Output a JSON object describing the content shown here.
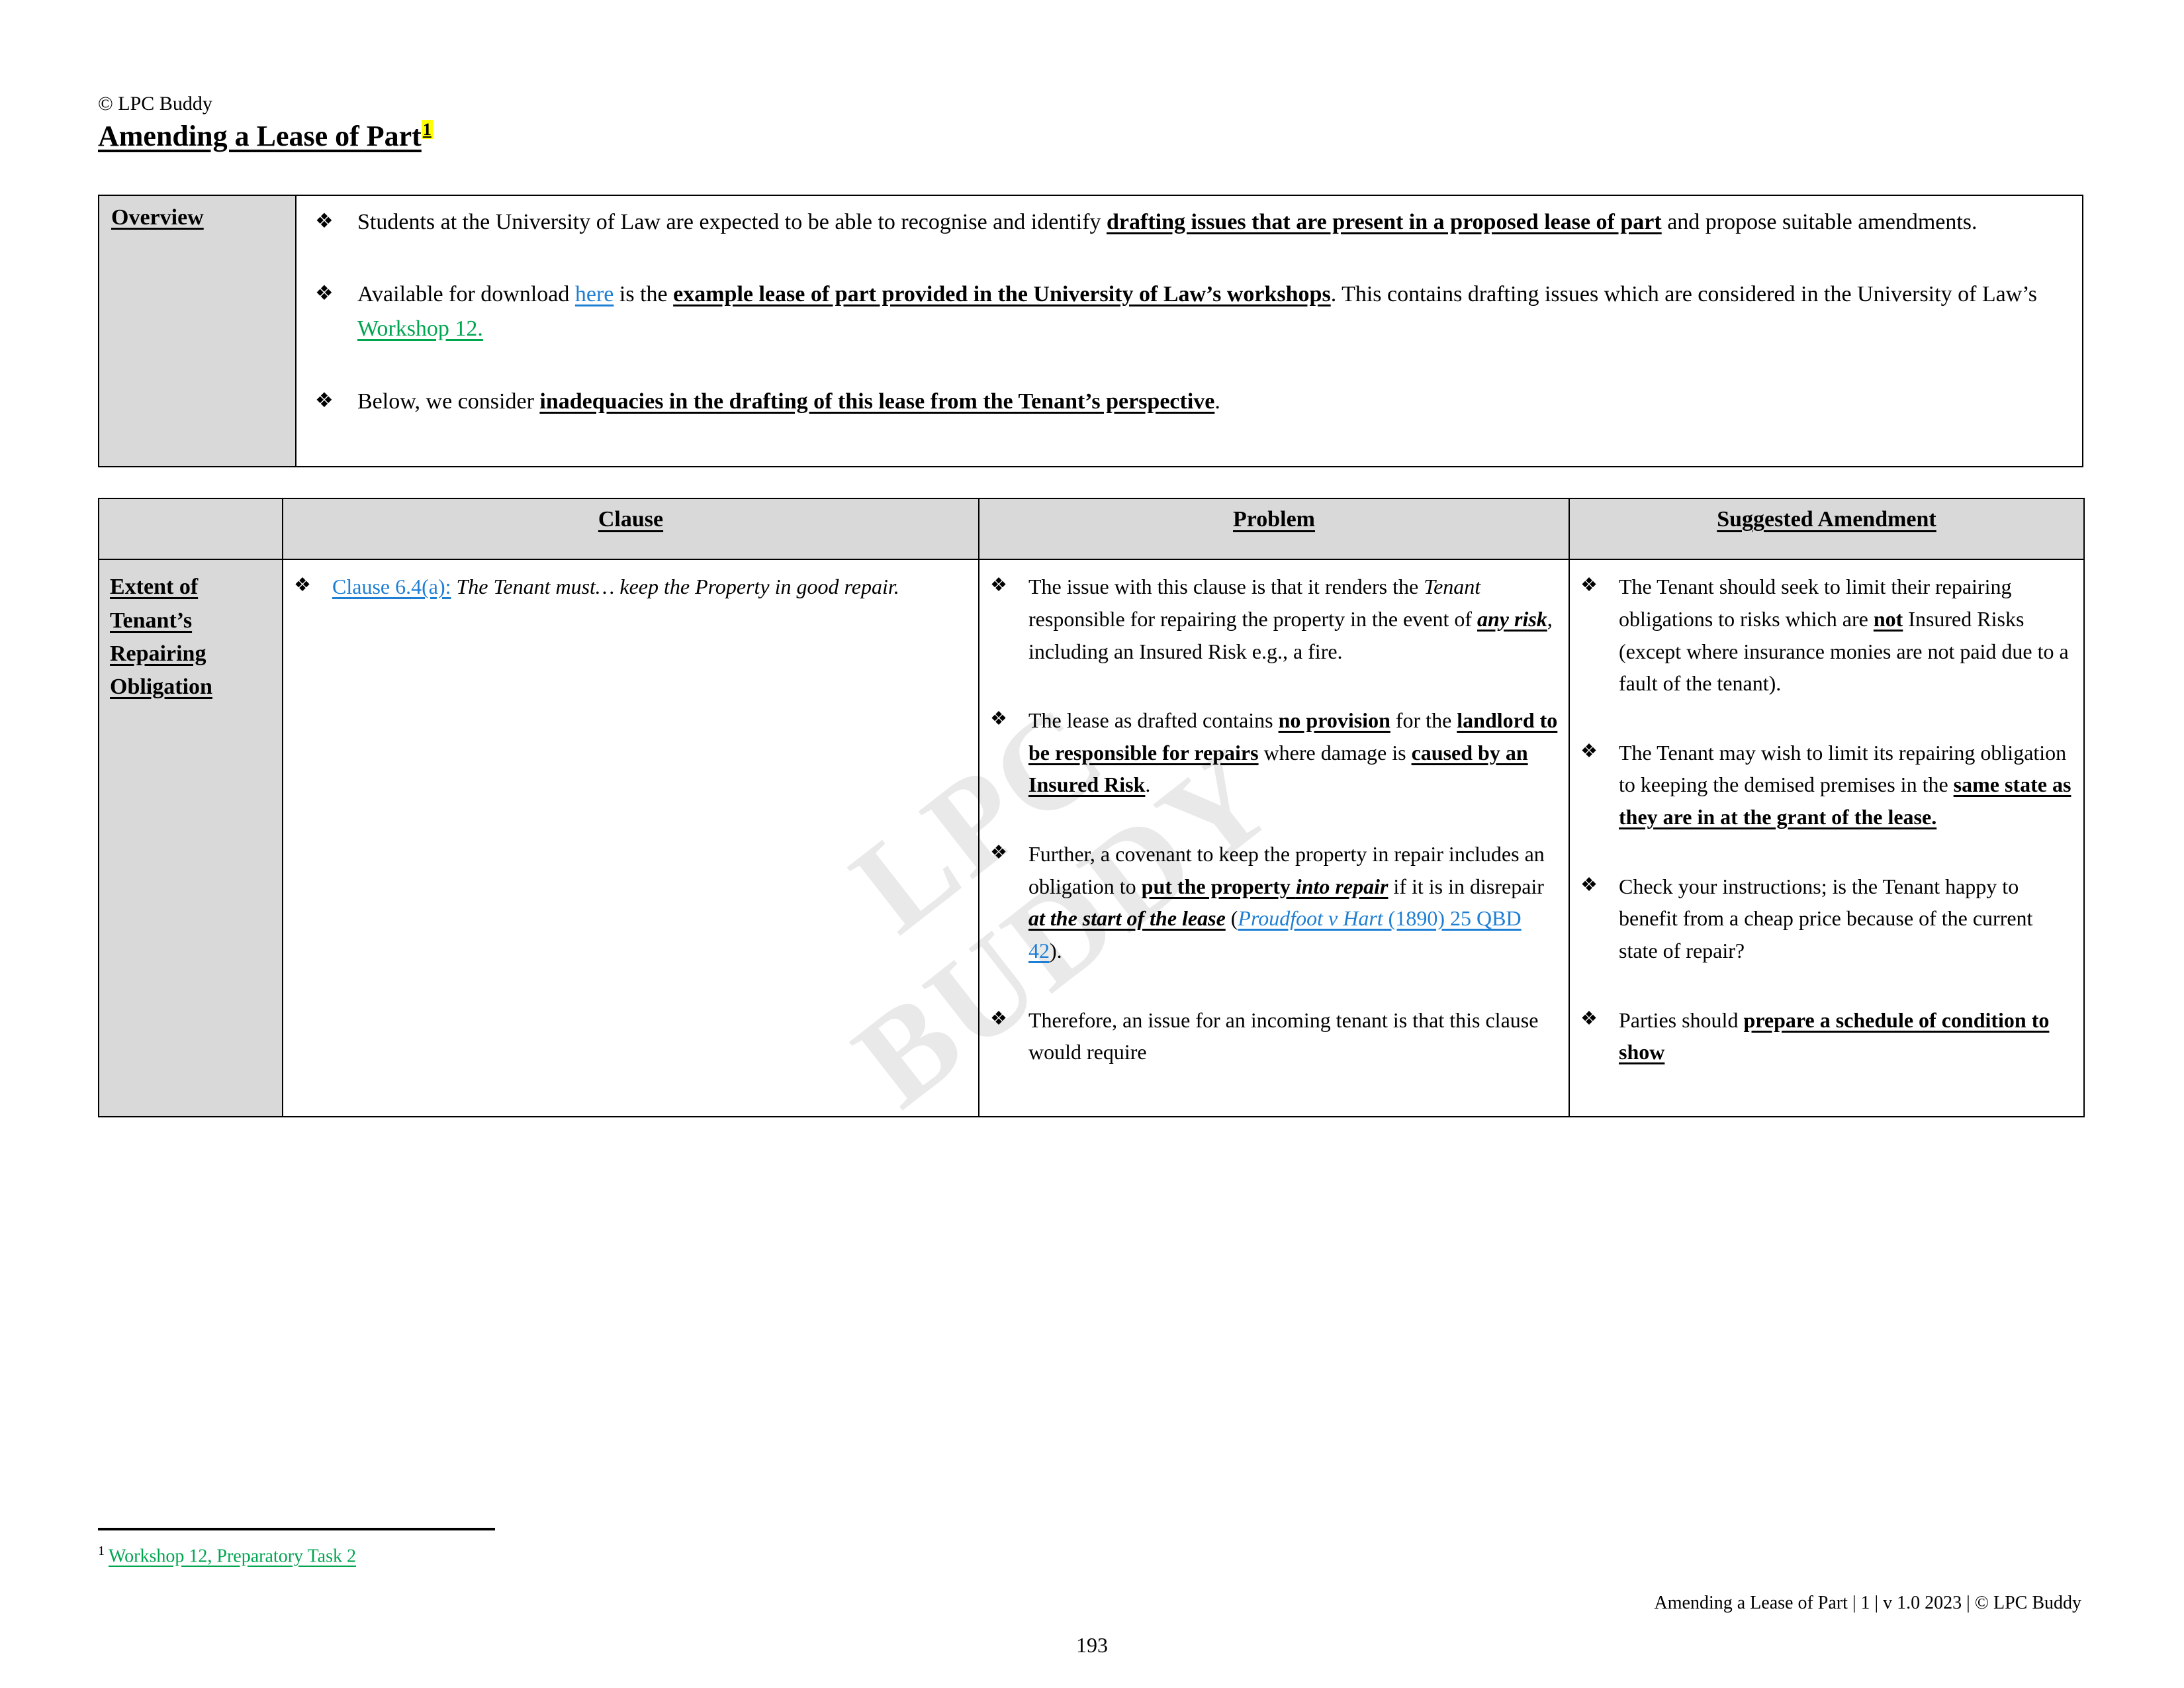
{
  "document": {
    "copyright_line": "© LPC Buddy",
    "title": "Amending a Lease of Part",
    "footnote_marker": "1",
    "page_number": "193"
  },
  "overview": {
    "label": "Overview",
    "bullets": {
      "b1": {
        "p1": "Students at the University of Law are expected to be able to recognise and identify ",
        "bold1": "drafting issues that are present in a proposed lease of part",
        "p2": " and propose suitable amendments."
      },
      "b2": {
        "p1": "Available for download ",
        "link_here": "here",
        "p2": " is the ",
        "bold1": "example lease of part provided in the University of Law’s workshops",
        "p3": ". This contains drafting issues which are considered in the University of Law’s ",
        "link_workshop": "Workshop 12."
      },
      "b3": {
        "p1": "Below, we consider ",
        "bold1": "inadequacies in the drafting of this lease from the Tenant’s perspective",
        "p2": "."
      }
    }
  },
  "main_table": {
    "headers": {
      "col0": "",
      "clause": "Clause",
      "problem": "Problem",
      "amendment": "Suggested Amendment"
    },
    "row1": {
      "label_lines": [
        "Extent of",
        "Tenant’s",
        "Repairing",
        "Obligation"
      ],
      "clause": {
        "b1": {
          "link": "Clause 6.4(a):",
          "italic": " The Tenant must… keep the Property in good repair."
        }
      },
      "problem": {
        "b1": {
          "p1": "The issue with this clause is that it renders the ",
          "i1": "Tenant",
          "p2": " responsible for repairing the property in the event of ",
          "biu1": "any risk",
          "p3": ", including an Insured Risk e.g., a fire."
        },
        "b2": {
          "p1": "The lease as drafted contains ",
          "bu1": "no provision",
          "p2": " for the ",
          "bu2": "landlord to be responsible for repairs",
          "p3": " where damage is ",
          "bu3": "caused by an Insured Risk",
          "p4": "."
        },
        "b3": {
          "p1": "Further, a covenant to keep the property in repair includes an obligation to ",
          "bu1": "put the property ",
          "biu1": "into repair",
          "p2": " if it is in disrepair ",
          "biu2": "at the start of the lease",
          "p3": " (",
          "link_case": "Proudfoot v Hart",
          "link_cite": " (1890) 25 QBD 42",
          "p4": ")."
        },
        "b4": {
          "p1": "Therefore, an issue for an incoming tenant is that this clause would require"
        }
      },
      "amendment": {
        "b1": {
          "p1": "The Tenant should seek to limit their repairing obligations to risks which are ",
          "bu1": "not",
          "p2": " Insured Risks (except where insurance monies are not paid due to a fault of the tenant)."
        },
        "b2": {
          "p1": "The Tenant may wish to limit its repairing obligation to keeping the demised premises in the ",
          "bu1": "same state as they are in at the grant of the lease."
        },
        "b3": {
          "p1": "Check your instructions; is the Tenant happy to benefit from a cheap price because of the current state of repair?"
        },
        "b4": {
          "p1": "Parties should ",
          "bu1": "prepare a schedule of condition to show"
        }
      }
    }
  },
  "footnote": {
    "number": "1",
    "text": "Workshop 12, Preparatory Task 2"
  },
  "footer": {
    "text": "Amending a Lease of Part | 1 | v 1.0 2023 | © LPC Buddy"
  },
  "watermark": {
    "line1": "LPC",
    "line2": "BUDDY"
  },
  "colors": {
    "link_blue": "#1f7fd4",
    "link_green": "#00a550",
    "shading_gray": "#d9d9d9",
    "highlight_yellow": "#ffff00"
  }
}
